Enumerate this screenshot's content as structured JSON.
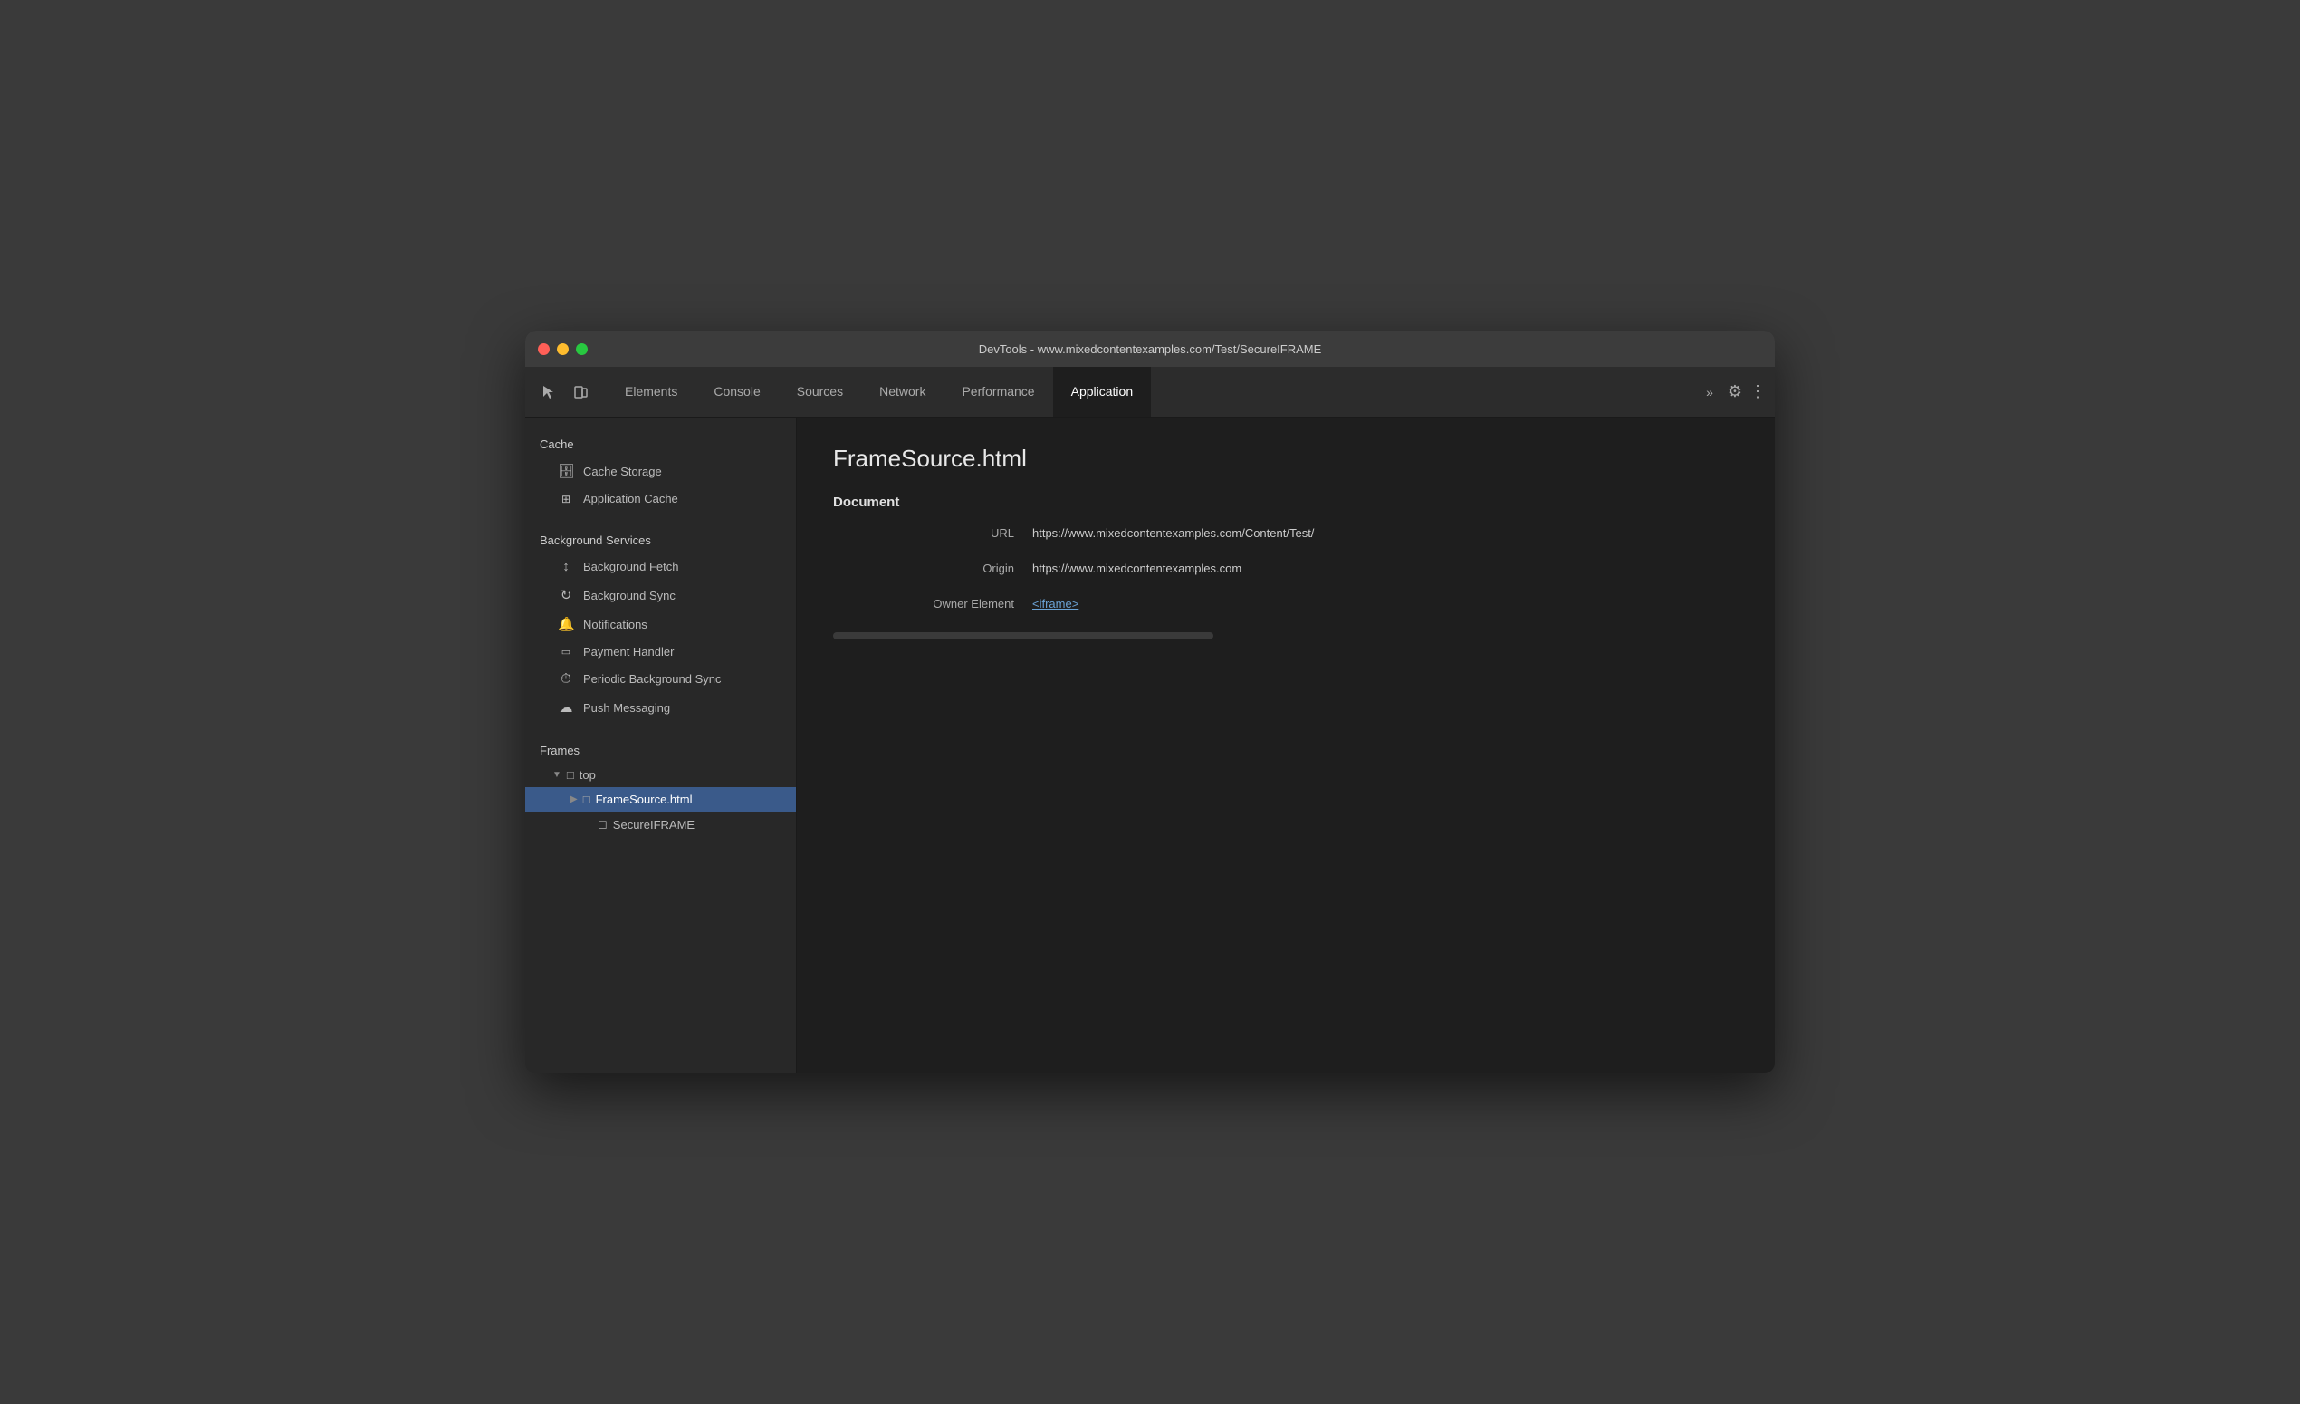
{
  "window": {
    "title": "DevTools - www.mixedcontentexamples.com/Test/SecureIFRAME"
  },
  "toolbar": {
    "tabs": [
      {
        "id": "elements",
        "label": "Elements",
        "active": false
      },
      {
        "id": "console",
        "label": "Console",
        "active": false
      },
      {
        "id": "sources",
        "label": "Sources",
        "active": false
      },
      {
        "id": "network",
        "label": "Network",
        "active": false
      },
      {
        "id": "performance",
        "label": "Performance",
        "active": false
      },
      {
        "id": "application",
        "label": "Application",
        "active": true
      }
    ],
    "more_label": "»",
    "gear_icon": "⚙",
    "dots_icon": "⋮"
  },
  "sidebar": {
    "sections": {
      "cache": {
        "label": "Cache",
        "items": [
          {
            "id": "cache-storage",
            "label": "Cache Storage",
            "icon": "🗄"
          },
          {
            "id": "application-cache",
            "label": "Application Cache",
            "icon": "⊞"
          }
        ]
      },
      "background_services": {
        "label": "Background Services",
        "items": [
          {
            "id": "background-fetch",
            "label": "Background Fetch",
            "icon": "↕"
          },
          {
            "id": "background-sync",
            "label": "Background Sync",
            "icon": "↻"
          },
          {
            "id": "notifications",
            "label": "Notifications",
            "icon": "🔔"
          },
          {
            "id": "payment-handler",
            "label": "Payment Handler",
            "icon": "▭"
          },
          {
            "id": "periodic-background-sync",
            "label": "Periodic Background Sync",
            "icon": "⏱"
          },
          {
            "id": "push-messaging",
            "label": "Push Messaging",
            "icon": "☁"
          }
        ]
      },
      "frames": {
        "label": "Frames",
        "tree": [
          {
            "id": "top",
            "label": "top",
            "indent": 1,
            "collapsed": false,
            "arrow": "▼"
          },
          {
            "id": "framesource",
            "label": "FrameSource.html",
            "indent": 2,
            "selected": true,
            "arrow": "▶"
          },
          {
            "id": "secureiframe",
            "label": "SecureIFRAME",
            "indent": 3,
            "arrow": ""
          }
        ]
      }
    }
  },
  "main": {
    "title": "FrameSource.html",
    "document": {
      "heading": "Document",
      "rows": [
        {
          "label": "URL",
          "value": "https://www.mixedcontentexamples.com/Content/Test/",
          "type": "text"
        },
        {
          "label": "Origin",
          "value": "https://www.mixedcontentexamples.com",
          "type": "text"
        },
        {
          "label": "Owner Element",
          "value": "<iframe>",
          "type": "link"
        }
      ]
    }
  }
}
